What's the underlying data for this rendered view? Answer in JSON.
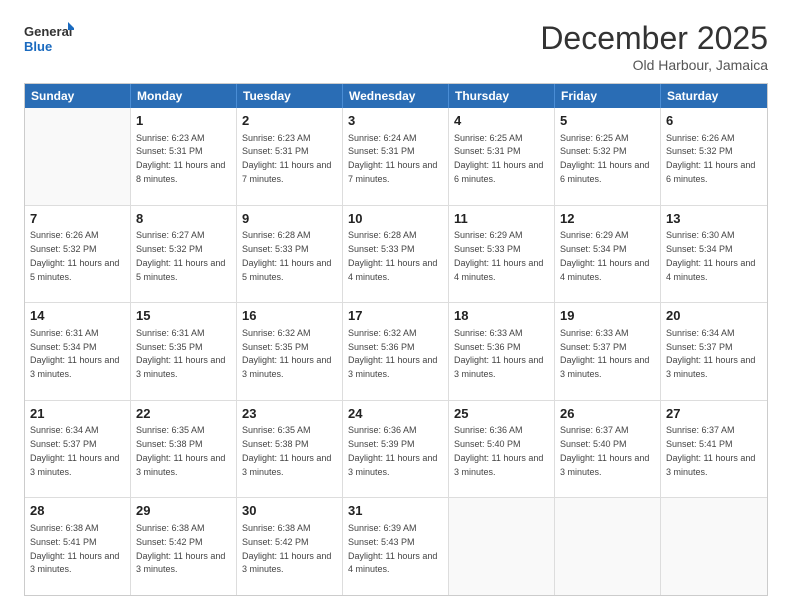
{
  "header": {
    "logo_general": "General",
    "logo_blue": "Blue",
    "month_title": "December 2025",
    "subtitle": "Old Harbour, Jamaica"
  },
  "days_of_week": [
    "Sunday",
    "Monday",
    "Tuesday",
    "Wednesday",
    "Thursday",
    "Friday",
    "Saturday"
  ],
  "weeks": [
    [
      {
        "day": "",
        "sunrise": "",
        "sunset": "",
        "daylight": ""
      },
      {
        "day": "1",
        "sunrise": "Sunrise: 6:23 AM",
        "sunset": "Sunset: 5:31 PM",
        "daylight": "Daylight: 11 hours and 8 minutes."
      },
      {
        "day": "2",
        "sunrise": "Sunrise: 6:23 AM",
        "sunset": "Sunset: 5:31 PM",
        "daylight": "Daylight: 11 hours and 7 minutes."
      },
      {
        "day": "3",
        "sunrise": "Sunrise: 6:24 AM",
        "sunset": "Sunset: 5:31 PM",
        "daylight": "Daylight: 11 hours and 7 minutes."
      },
      {
        "day": "4",
        "sunrise": "Sunrise: 6:25 AM",
        "sunset": "Sunset: 5:31 PM",
        "daylight": "Daylight: 11 hours and 6 minutes."
      },
      {
        "day": "5",
        "sunrise": "Sunrise: 6:25 AM",
        "sunset": "Sunset: 5:32 PM",
        "daylight": "Daylight: 11 hours and 6 minutes."
      },
      {
        "day": "6",
        "sunrise": "Sunrise: 6:26 AM",
        "sunset": "Sunset: 5:32 PM",
        "daylight": "Daylight: 11 hours and 6 minutes."
      }
    ],
    [
      {
        "day": "7",
        "sunrise": "Sunrise: 6:26 AM",
        "sunset": "Sunset: 5:32 PM",
        "daylight": "Daylight: 11 hours and 5 minutes."
      },
      {
        "day": "8",
        "sunrise": "Sunrise: 6:27 AM",
        "sunset": "Sunset: 5:32 PM",
        "daylight": "Daylight: 11 hours and 5 minutes."
      },
      {
        "day": "9",
        "sunrise": "Sunrise: 6:28 AM",
        "sunset": "Sunset: 5:33 PM",
        "daylight": "Daylight: 11 hours and 5 minutes."
      },
      {
        "day": "10",
        "sunrise": "Sunrise: 6:28 AM",
        "sunset": "Sunset: 5:33 PM",
        "daylight": "Daylight: 11 hours and 4 minutes."
      },
      {
        "day": "11",
        "sunrise": "Sunrise: 6:29 AM",
        "sunset": "Sunset: 5:33 PM",
        "daylight": "Daylight: 11 hours and 4 minutes."
      },
      {
        "day": "12",
        "sunrise": "Sunrise: 6:29 AM",
        "sunset": "Sunset: 5:34 PM",
        "daylight": "Daylight: 11 hours and 4 minutes."
      },
      {
        "day": "13",
        "sunrise": "Sunrise: 6:30 AM",
        "sunset": "Sunset: 5:34 PM",
        "daylight": "Daylight: 11 hours and 4 minutes."
      }
    ],
    [
      {
        "day": "14",
        "sunrise": "Sunrise: 6:31 AM",
        "sunset": "Sunset: 5:34 PM",
        "daylight": "Daylight: 11 hours and 3 minutes."
      },
      {
        "day": "15",
        "sunrise": "Sunrise: 6:31 AM",
        "sunset": "Sunset: 5:35 PM",
        "daylight": "Daylight: 11 hours and 3 minutes."
      },
      {
        "day": "16",
        "sunrise": "Sunrise: 6:32 AM",
        "sunset": "Sunset: 5:35 PM",
        "daylight": "Daylight: 11 hours and 3 minutes."
      },
      {
        "day": "17",
        "sunrise": "Sunrise: 6:32 AM",
        "sunset": "Sunset: 5:36 PM",
        "daylight": "Daylight: 11 hours and 3 minutes."
      },
      {
        "day": "18",
        "sunrise": "Sunrise: 6:33 AM",
        "sunset": "Sunset: 5:36 PM",
        "daylight": "Daylight: 11 hours and 3 minutes."
      },
      {
        "day": "19",
        "sunrise": "Sunrise: 6:33 AM",
        "sunset": "Sunset: 5:37 PM",
        "daylight": "Daylight: 11 hours and 3 minutes."
      },
      {
        "day": "20",
        "sunrise": "Sunrise: 6:34 AM",
        "sunset": "Sunset: 5:37 PM",
        "daylight": "Daylight: 11 hours and 3 minutes."
      }
    ],
    [
      {
        "day": "21",
        "sunrise": "Sunrise: 6:34 AM",
        "sunset": "Sunset: 5:37 PM",
        "daylight": "Daylight: 11 hours and 3 minutes."
      },
      {
        "day": "22",
        "sunrise": "Sunrise: 6:35 AM",
        "sunset": "Sunset: 5:38 PM",
        "daylight": "Daylight: 11 hours and 3 minutes."
      },
      {
        "day": "23",
        "sunrise": "Sunrise: 6:35 AM",
        "sunset": "Sunset: 5:38 PM",
        "daylight": "Daylight: 11 hours and 3 minutes."
      },
      {
        "day": "24",
        "sunrise": "Sunrise: 6:36 AM",
        "sunset": "Sunset: 5:39 PM",
        "daylight": "Daylight: 11 hours and 3 minutes."
      },
      {
        "day": "25",
        "sunrise": "Sunrise: 6:36 AM",
        "sunset": "Sunset: 5:40 PM",
        "daylight": "Daylight: 11 hours and 3 minutes."
      },
      {
        "day": "26",
        "sunrise": "Sunrise: 6:37 AM",
        "sunset": "Sunset: 5:40 PM",
        "daylight": "Daylight: 11 hours and 3 minutes."
      },
      {
        "day": "27",
        "sunrise": "Sunrise: 6:37 AM",
        "sunset": "Sunset: 5:41 PM",
        "daylight": "Daylight: 11 hours and 3 minutes."
      }
    ],
    [
      {
        "day": "28",
        "sunrise": "Sunrise: 6:38 AM",
        "sunset": "Sunset: 5:41 PM",
        "daylight": "Daylight: 11 hours and 3 minutes."
      },
      {
        "day": "29",
        "sunrise": "Sunrise: 6:38 AM",
        "sunset": "Sunset: 5:42 PM",
        "daylight": "Daylight: 11 hours and 3 minutes."
      },
      {
        "day": "30",
        "sunrise": "Sunrise: 6:38 AM",
        "sunset": "Sunset: 5:42 PM",
        "daylight": "Daylight: 11 hours and 3 minutes."
      },
      {
        "day": "31",
        "sunrise": "Sunrise: 6:39 AM",
        "sunset": "Sunset: 5:43 PM",
        "daylight": "Daylight: 11 hours and 4 minutes."
      },
      {
        "day": "",
        "sunrise": "",
        "sunset": "",
        "daylight": ""
      },
      {
        "day": "",
        "sunrise": "",
        "sunset": "",
        "daylight": ""
      },
      {
        "day": "",
        "sunrise": "",
        "sunset": "",
        "daylight": ""
      }
    ]
  ]
}
